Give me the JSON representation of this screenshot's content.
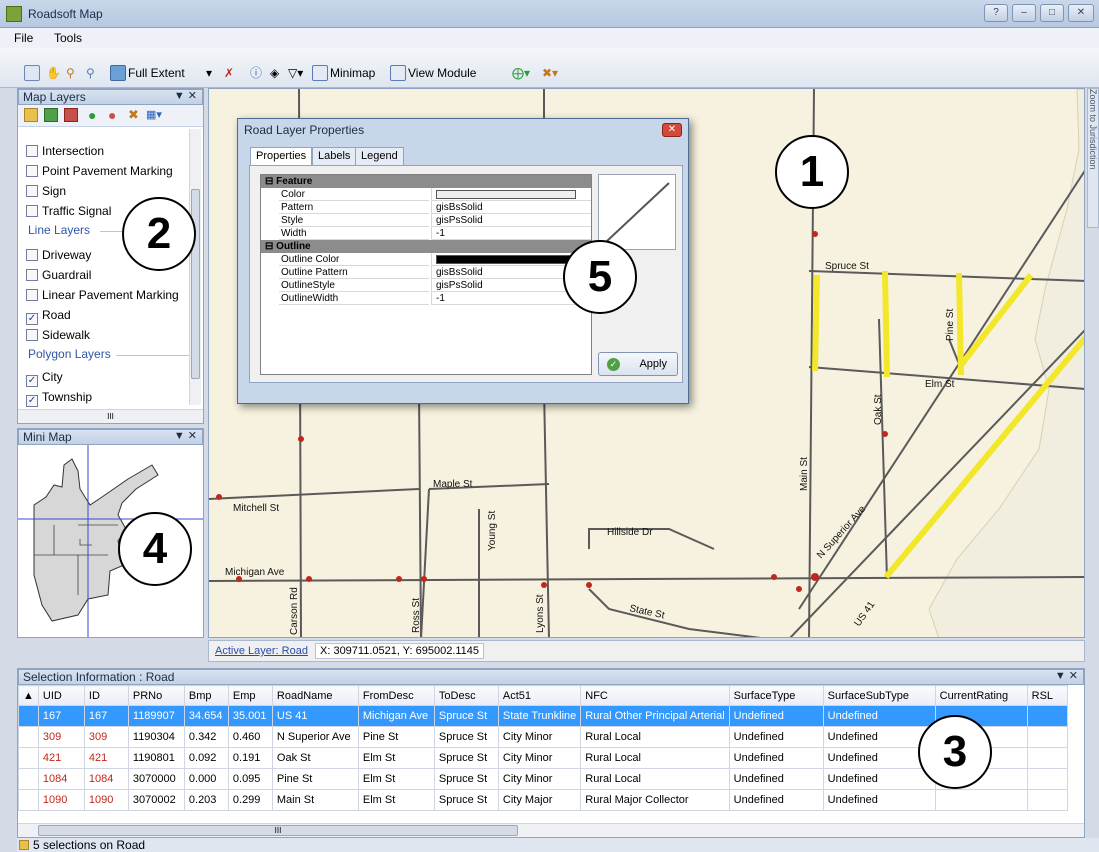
{
  "window": {
    "title": "Roadsoft Map"
  },
  "menu": {
    "file": "File",
    "tools": "Tools"
  },
  "toolbar": {
    "full_extent": "Full Extent",
    "minimap": "Minimap",
    "view_module": "View Module"
  },
  "layers_pane": {
    "title": "Map Layers",
    "items": [
      {
        "label": "Intersection",
        "checked": false
      },
      {
        "label": "Point Pavement Marking",
        "checked": false
      },
      {
        "label": "Sign",
        "checked": false
      },
      {
        "label": "Traffic Signal",
        "checked": false
      }
    ],
    "line_group": "Line Layers",
    "line_items": [
      {
        "label": "Driveway",
        "checked": false
      },
      {
        "label": "Guardrail",
        "checked": false
      },
      {
        "label": "Linear Pavement Marking",
        "checked": false
      },
      {
        "label": "Road",
        "checked": true
      },
      {
        "label": "Sidewalk",
        "checked": false
      }
    ],
    "polygon_group": "Polygon Layers",
    "polygon_items": [
      {
        "label": "City",
        "checked": true
      },
      {
        "label": "Township",
        "checked": true
      }
    ],
    "scroll_grip": "III"
  },
  "minimap_pane": {
    "title": "Mini Map"
  },
  "map": {
    "streets": [
      "Spruce St",
      "Pine St",
      "Elm St",
      "Oak St",
      "Main St",
      "N Superior Ave",
      "US 41",
      "Maple St",
      "Mitchell St",
      "Hillside Dr",
      "Young St",
      "Michigan Ave",
      "Carson Rd",
      "Ross St",
      "Lyons St",
      "State St"
    ],
    "side_tab": "Zoom to Jurisdiction"
  },
  "status": {
    "active_layer": "Active Layer: Road",
    "coords": "X: 309711.0521, Y: 695002.1145"
  },
  "dialog": {
    "title": "Road Layer Properties",
    "tabs": [
      "Properties",
      "Labels",
      "Legend"
    ],
    "categories": [
      "Feature",
      "Outline"
    ],
    "feature_rows": [
      {
        "name": "Color",
        "value": ""
      },
      {
        "name": "Pattern",
        "value": "gisBsSolid"
      },
      {
        "name": "Style",
        "value": "gisPsSolid"
      },
      {
        "name": "Width",
        "value": "-1"
      }
    ],
    "outline_rows": [
      {
        "name": "Outline Color",
        "value": ""
      },
      {
        "name": "Outline Pattern",
        "value": "gisBsSolid"
      },
      {
        "name": "OutlineStyle",
        "value": "gisPsSolid"
      },
      {
        "name": "OutlineWidth",
        "value": "-1"
      }
    ],
    "apply": "Apply",
    "colors": {
      "feature_color": "#eeeeee",
      "outline_color": "#000000"
    }
  },
  "selection": {
    "title": "Selection Information : Road",
    "columns": [
      "UID",
      "ID",
      "PRNo",
      "Bmp",
      "Emp",
      "RoadName",
      "FromDesc",
      "ToDesc",
      "Act51",
      "NFC",
      "SurfaceType",
      "SurfaceSubType",
      "CurrentRating",
      "RSL"
    ],
    "rows": [
      [
        "167",
        "167",
        "1189907",
        "34.654",
        "35.001",
        "US 41",
        "Michigan Ave",
        "Spruce St",
        "State Trunkline",
        "Rural Other Principal Arterial",
        "Undefined",
        "Undefined",
        "",
        ""
      ],
      [
        "309",
        "309",
        "1190304",
        "0.342",
        "0.460",
        "N Superior Ave",
        "Pine St",
        "Spruce St",
        "City Minor",
        "Rural Local",
        "Undefined",
        "Undefined",
        "",
        ""
      ],
      [
        "421",
        "421",
        "1190801",
        "0.092",
        "0.191",
        "Oak St",
        "Elm St",
        "Spruce St",
        "City Minor",
        "Rural Local",
        "Undefined",
        "Undefined",
        "",
        ""
      ],
      [
        "1084",
        "1084",
        "3070000",
        "0.000",
        "0.095",
        "Pine St",
        "Elm St",
        "Spruce St",
        "City Minor",
        "Rural Local",
        "Undefined",
        "Undefined",
        "",
        ""
      ],
      [
        "1090",
        "1090",
        "3070002",
        "0.203",
        "0.299",
        "Main St",
        "Elm St",
        "Spruce St",
        "City Major",
        "Rural Major Collector",
        "Undefined",
        "Undefined",
        "",
        ""
      ]
    ],
    "selected_row": 0,
    "scroll_grip": "III",
    "footer": "5 selections on Road"
  },
  "callouts": [
    "1",
    "2",
    "3",
    "4",
    "5"
  ],
  "colors": {
    "highlight_road": "#f2e72a",
    "selection_row": "#3399ff",
    "map_bg": "#f7f2df"
  }
}
